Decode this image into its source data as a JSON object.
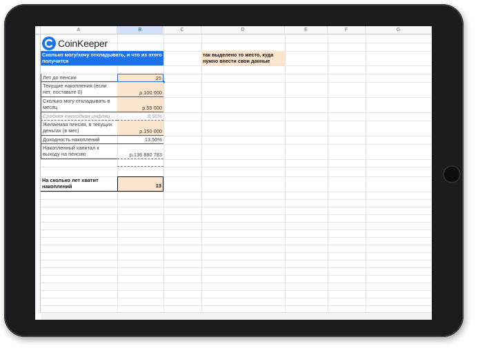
{
  "sheet": {
    "columns": [
      "A",
      "B",
      "C",
      "D",
      "E",
      "F",
      "G"
    ],
    "selected_column": "B",
    "brand": "CoinKeeper",
    "header_title": "Сколько могу/хочу откладывать, и что из этого получится",
    "note": "так выделено то место, куда нужно внести свои данные",
    "rows": [
      {
        "label": "Лет до пенсии",
        "value": "25"
      },
      {
        "label": "Текущие накопления (если нет, поставьте 0)",
        "value": "р.100 000"
      },
      {
        "label": "Сколько могу откладывать в месяц",
        "value": "р.55 000"
      },
      {
        "label": "Средняя ежегодная инфляц",
        "value": "8,50%"
      },
      {
        "label": "Желаемая пенсия, в текущих деньгах (в мес)",
        "value": "р.150 000"
      },
      {
        "label": "Доходность накоплений",
        "value": "13,50%"
      },
      {
        "label": "Накопленный капитал к выходу на пенсию",
        "value": "р.136 880 783"
      }
    ],
    "result_label": "На сколько лет хватит накоплений",
    "result_value": "13"
  },
  "colors": {
    "input_fill": "#fce5cd",
    "header_fill": "#1a73e8",
    "selection": "#1a73e8"
  }
}
